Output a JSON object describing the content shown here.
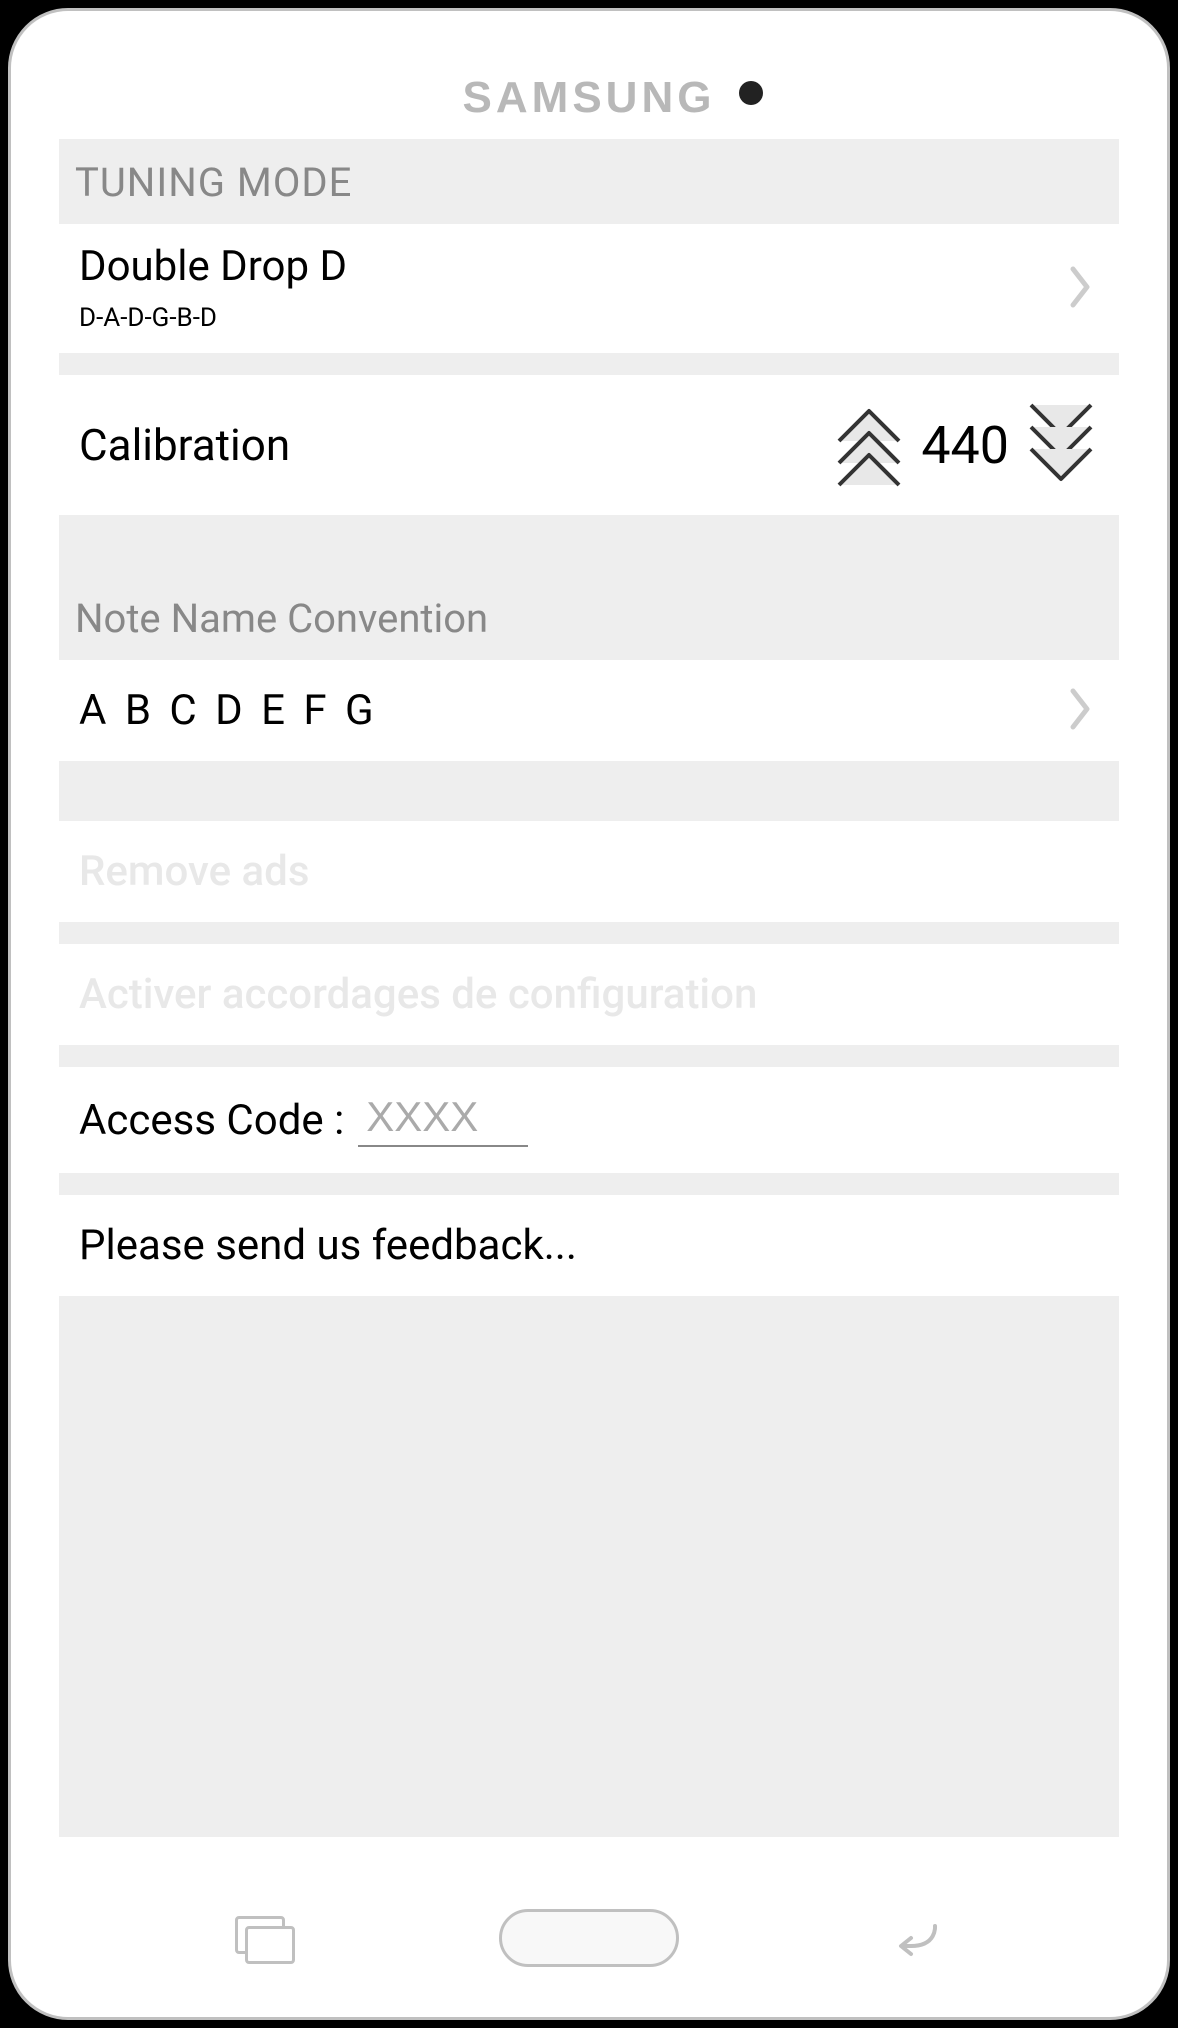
{
  "brand": "SAMSUNG",
  "sections": {
    "tuning_mode_header": "TUNING MODE",
    "note_convention_header": "Note Name Convention"
  },
  "tuning": {
    "name": "Double Drop D",
    "notes": "D-A-D-G-B-D"
  },
  "calibration": {
    "label": "Calibration",
    "value": "440"
  },
  "note_convention": {
    "value": "A B C D E F G"
  },
  "remove_ads": "Remove ads",
  "activate_configs": "Activer accordages de configuration",
  "access_code": {
    "label": "Access Code :",
    "placeholder": "XXXX"
  },
  "feedback": "Please send us feedback..."
}
